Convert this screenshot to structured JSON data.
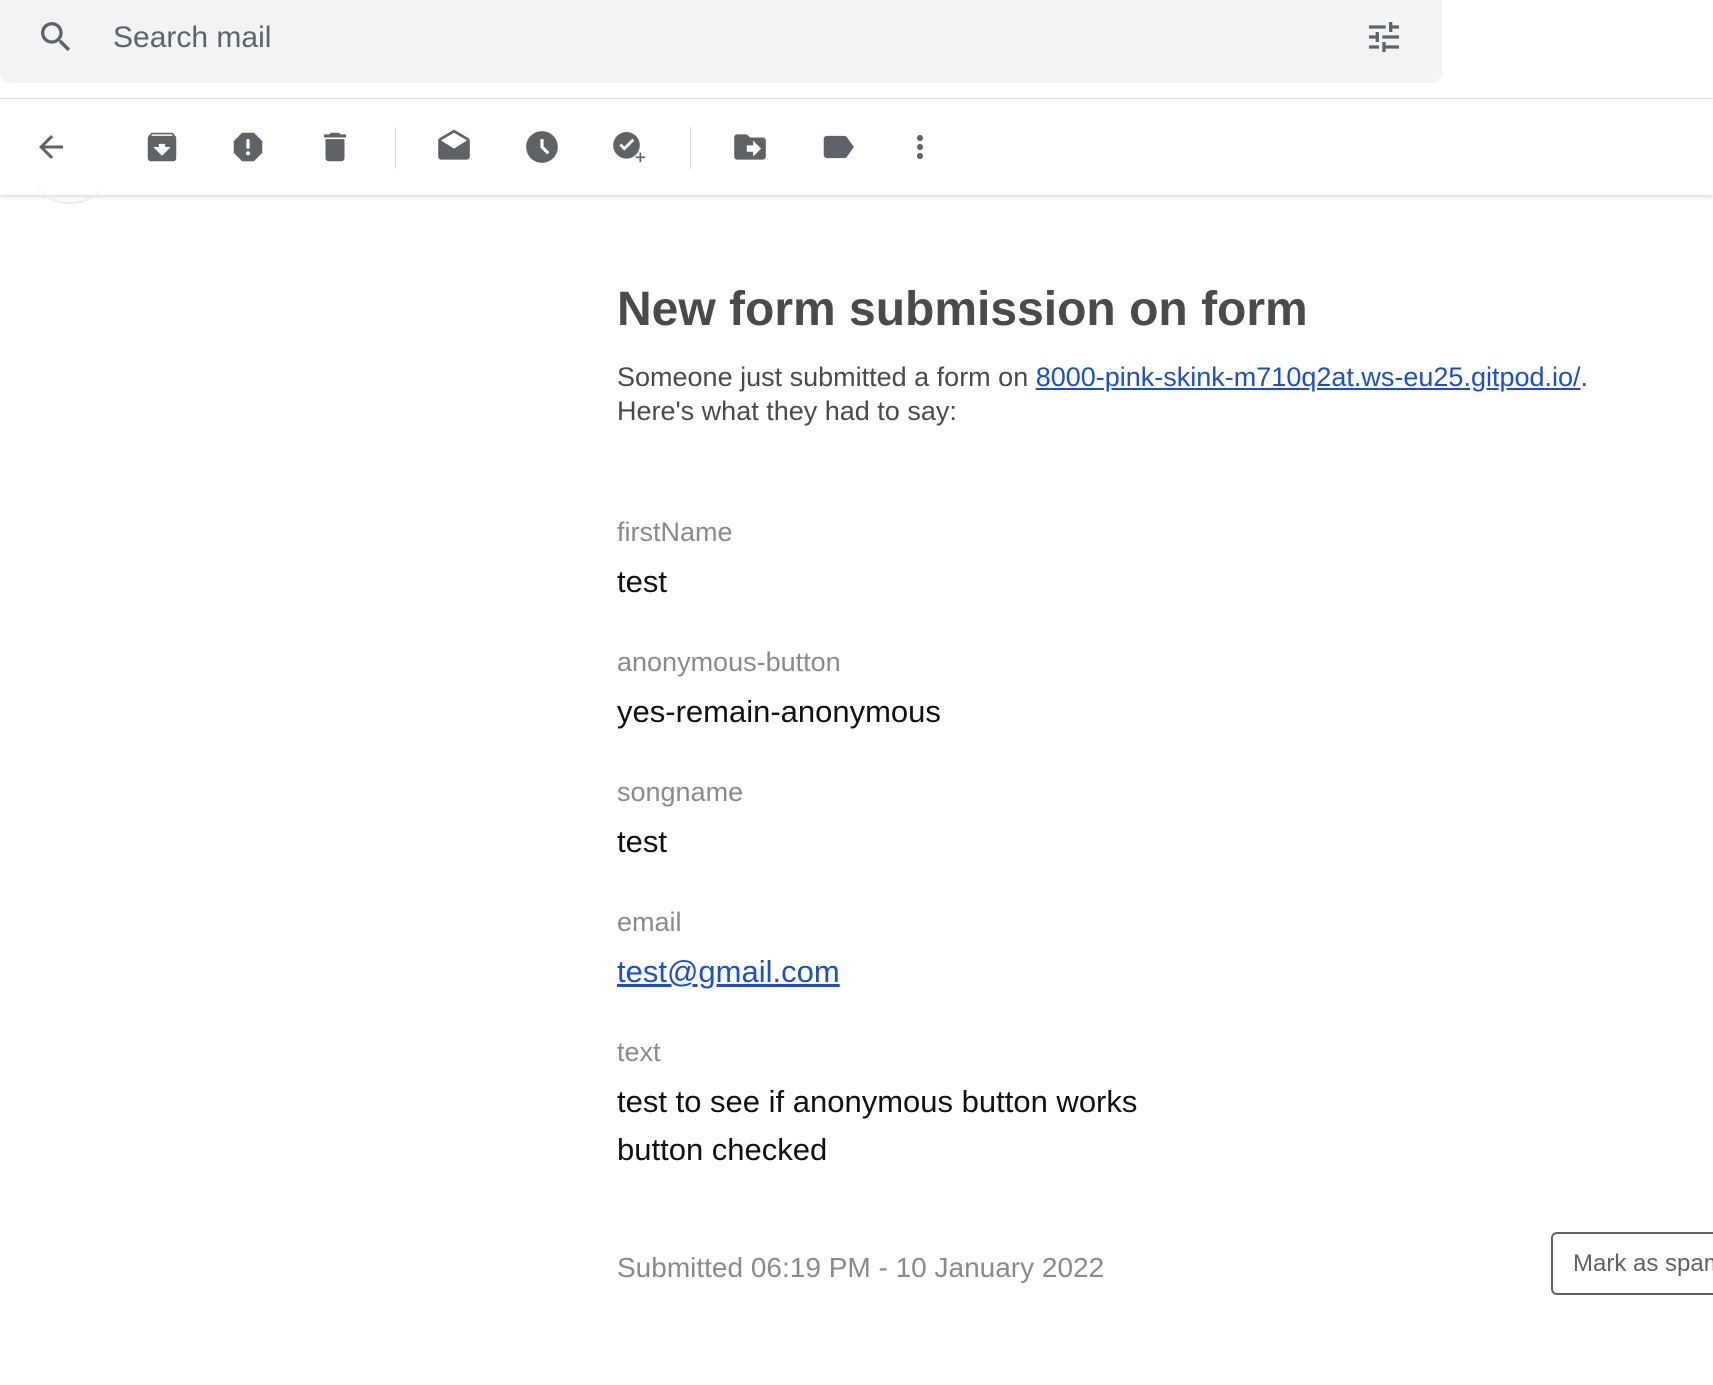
{
  "search": {
    "placeholder": "Search mail",
    "search_icon": "search-icon",
    "options_icon": "tune-icon"
  },
  "toolbar": {
    "icons": [
      "back-arrow-icon",
      "archive-icon",
      "report-spam-icon",
      "delete-icon",
      "mark-unread-icon",
      "snooze-icon",
      "add-to-tasks-icon",
      "move-to-icon",
      "label-icon",
      "more-options-icon"
    ]
  },
  "message": {
    "title": "New form submission on form",
    "intro_before": "Someone just submitted a form on ",
    "intro_link": "8000-pink-skink-m710q2at.ws-eu25.gitpod.io/",
    "intro_after": ".",
    "intro_line2": "Here's what they had to say:",
    "fields": [
      {
        "label": "firstName",
        "value": "test"
      },
      {
        "label": "anonymous-button",
        "value": "yes-remain-anonymous"
      },
      {
        "label": "songname",
        "value": "test"
      },
      {
        "label": "email",
        "value": "test@gmail.com"
      },
      {
        "label": "text",
        "value_lines": [
          "test to see if anonymous button works",
          "button checked"
        ]
      }
    ],
    "submitted": "Submitted 06:19 PM - 10 January 2022"
  },
  "spam_button": {
    "label": "Mark as spam"
  },
  "colors": {
    "link": "#1a4fd1",
    "icon": "#5f6368",
    "search_bg": "#f1f3f4"
  }
}
